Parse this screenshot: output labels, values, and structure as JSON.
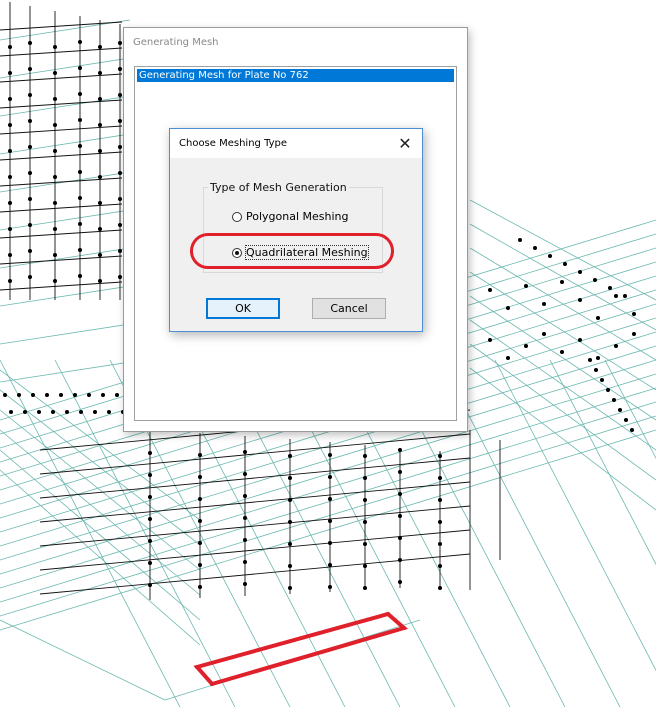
{
  "background": {
    "description_icon": "structural-wireframe-model",
    "line_color": "#5fb0a8",
    "node_color": "#000000",
    "selection_color": "#e0202a"
  },
  "outer_dialog": {
    "title": "Generating Mesh",
    "list_items": [
      "Generating Mesh for Plate No 762"
    ]
  },
  "inner_dialog": {
    "title": "Choose Meshing Type",
    "group_label": "Type of Mesh Generation",
    "options": [
      {
        "label": "Polygonal Meshing",
        "selected": false
      },
      {
        "label": "Quadrilateral Meshing",
        "selected": true
      }
    ],
    "ok_label": "OK",
    "cancel_label": "Cancel"
  },
  "colors": {
    "accent": "#0078d7",
    "highlight_annotation": "#e0202a"
  }
}
